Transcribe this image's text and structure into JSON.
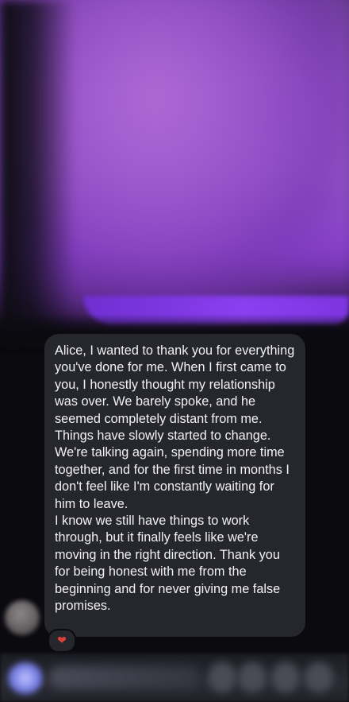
{
  "message": {
    "paragraphs": [
      "Alice, I wanted to thank you for everything you've done for me. When I first came to you, I honestly thought my relationship was over. We barely spoke, and he seemed completely distant from me.",
      "Things have slowly started to change. We're talking again, spending more time together, and for the first time in months I don't feel like I'm constantly waiting for him to leave.",
      "I know we still have things to work through, but it finally feels like we're moving in the right direction. Thank you for being honest with me from the beginning and for never giving me false promises."
    ],
    "reaction": "❤"
  },
  "colors": {
    "bubble": "#26272c",
    "background": "#0a0a0f",
    "media_accent": "#8a3ff0",
    "reaction_heart": "#e0403a"
  },
  "icons": {
    "reaction": "heart-icon"
  }
}
